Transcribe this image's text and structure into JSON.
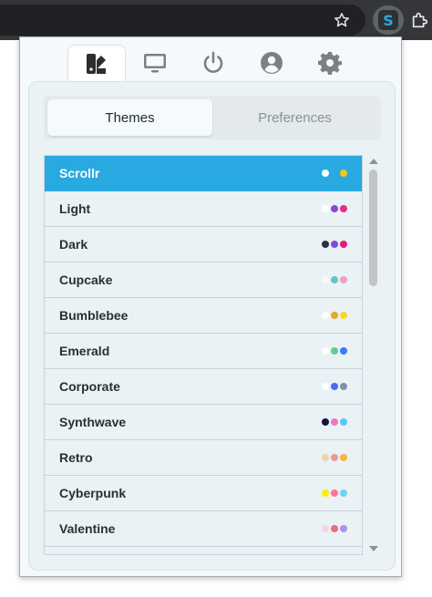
{
  "browser": {
    "star_icon": "star-icon",
    "extension_icon": "scrollr-s-icon",
    "extensions_icon": "puzzle-icon",
    "extension_letter": "S",
    "extension_color": "#2ea8e0"
  },
  "icon_tabs": [
    {
      "name": "themes-tab",
      "icon": "palette-icon",
      "active": true
    },
    {
      "name": "display-tab",
      "icon": "monitor-icon",
      "active": false
    },
    {
      "name": "power-tab",
      "icon": "power-icon",
      "active": false
    },
    {
      "name": "account-tab",
      "icon": "user-circle-icon",
      "active": false
    },
    {
      "name": "settings-tab",
      "icon": "gear-icon",
      "active": false
    }
  ],
  "tabs": {
    "themes": "Themes",
    "preferences": "Preferences",
    "active": "themes"
  },
  "themes": [
    {
      "name": "Scrollr",
      "selected": true,
      "colors": [
        "#ffffff",
        "#29a9e1",
        "#f5c518"
      ]
    },
    {
      "name": "Light",
      "selected": false,
      "colors": [
        "#ffffff",
        "#8e44d6",
        "#ec2a88"
      ]
    },
    {
      "name": "Dark",
      "selected": false,
      "colors": [
        "#2a323c",
        "#7c4ddb",
        "#e51a7a"
      ]
    },
    {
      "name": "Cupcake",
      "selected": false,
      "colors": [
        "#faf7f5",
        "#65c3c8",
        "#ef9fbc"
      ]
    },
    {
      "name": "Bumblebee",
      "selected": false,
      "colors": [
        "#ffffff",
        "#e0a82e",
        "#f9d72f"
      ]
    },
    {
      "name": "Emerald",
      "selected": false,
      "colors": [
        "#ffffff",
        "#66cc8a",
        "#377cfb"
      ]
    },
    {
      "name": "Corporate",
      "selected": false,
      "colors": [
        "#ffffff",
        "#4b6bfb",
        "#7b92b2"
      ]
    },
    {
      "name": "Synthwave",
      "selected": false,
      "colors": [
        "#1a103d",
        "#e779c1",
        "#58c7f3"
      ]
    },
    {
      "name": "Retro",
      "selected": false,
      "colors": [
        "#e4d8b4",
        "#ef9995",
        "#f4b63f"
      ]
    },
    {
      "name": "Cyberpunk",
      "selected": false,
      "colors": [
        "#ffee00",
        "#ff7598",
        "#75d1f0"
      ]
    },
    {
      "name": "Valentine",
      "selected": false,
      "colors": [
        "#f0d6e8",
        "#e96d7b",
        "#a991f7"
      ]
    }
  ]
}
